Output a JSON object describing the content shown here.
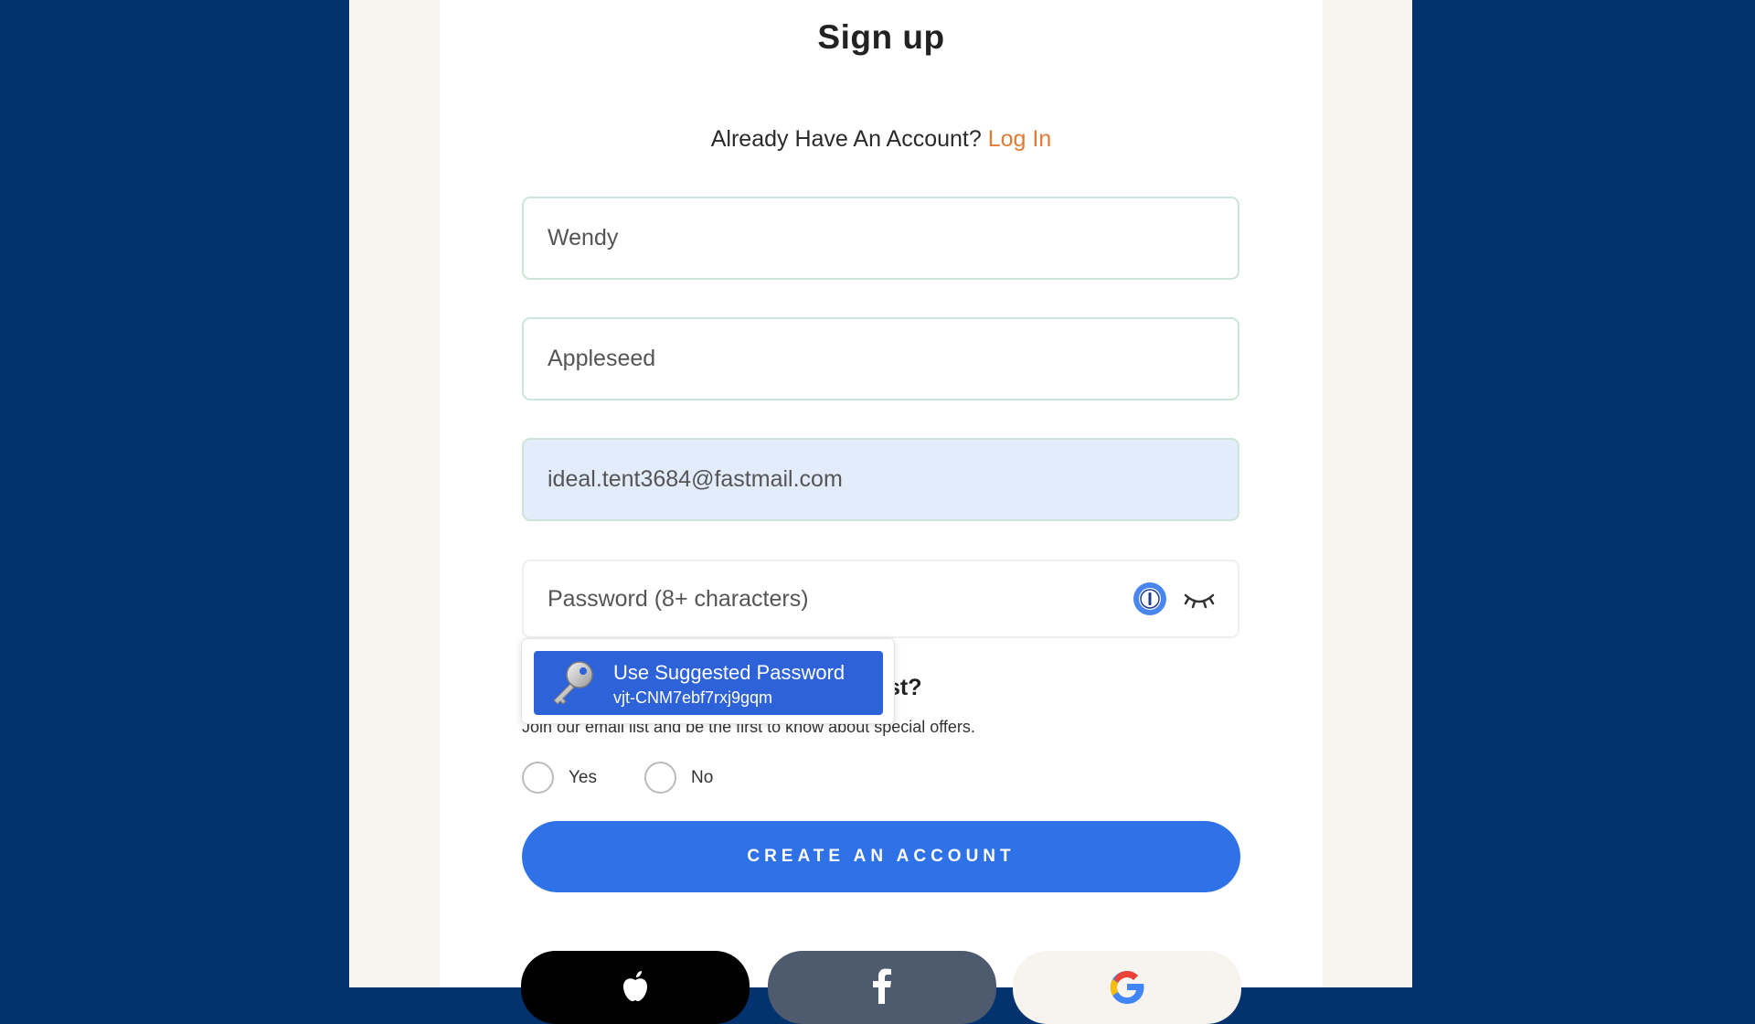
{
  "page": {
    "title": "Sign up",
    "login_prompt": "Already Have An Account?",
    "login_link": "Log In"
  },
  "form": {
    "first_name": "Wendy",
    "last_name": "Appleseed",
    "email": "ideal.tent3684@fastmail.com",
    "password_placeholder": "Password (8+ characters)"
  },
  "password_manager": {
    "suggest_title": "Use Suggested Password",
    "suggested_password": "vjt-CNM7ebf7rxj9gqm"
  },
  "newsletter": {
    "heading_visible_fragment": "st?",
    "subtext": "Join our email list and be the first to know about special offers.",
    "options": [
      {
        "label": "Yes"
      },
      {
        "label": "No"
      }
    ]
  },
  "actions": {
    "create_account": "CREATE AN ACCOUNT"
  },
  "social": {
    "buttons": [
      "apple",
      "facebook",
      "google"
    ]
  },
  "colors": {
    "page_background": "#03336e",
    "accent_blue": "#2f72e8",
    "login_link": "#e07a35",
    "autofill_background": "#e2ecfb"
  },
  "icons": [
    "onepassword-icon",
    "eye-closed-icon",
    "key-icon",
    "apple-icon",
    "facebook-icon",
    "google-icon"
  ]
}
